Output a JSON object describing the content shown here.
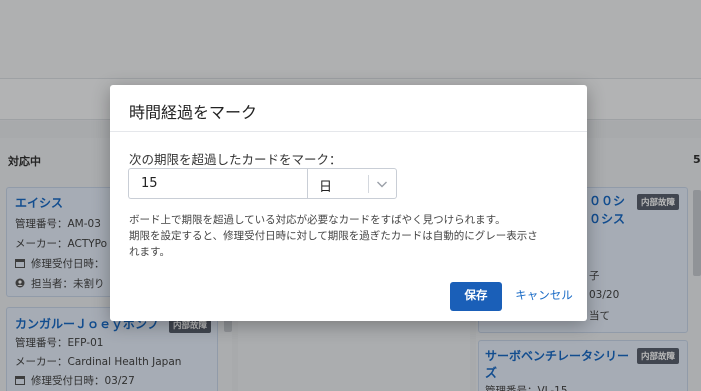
{
  "background": {
    "columns": [
      {
        "header": "対応中",
        "cards": [
          {
            "title": "エイシス",
            "mgmt": "管理番号：AM-03",
            "maker": "メーカー：ACTYPo",
            "received": "修理受付日時：",
            "assignee": "担当者：未割り"
          },
          {
            "title": "カンガルーＪｏｅｙポンプ",
            "tag": "内部故障",
            "mgmt": "管理番号：EFP-01",
            "maker": "メーカー：Cardinal Health Japan",
            "received": "修理受付日時：03/27"
          }
        ]
      },
      {
        "header": "5",
        "cards": [
          {
            "title_line1": "００シ",
            "title_line2": "０シス",
            "tag": "内部故障",
            "line1": "子",
            "line2": "03/20",
            "line3": "当て"
          },
          {
            "title_line1": "サーボベンチレータシリー",
            "title_line2": "ズ",
            "tag": "内部故障",
            "mgmt": "管理番号：VL-15"
          }
        ]
      }
    ]
  },
  "modal": {
    "title": "時間経過をマーク",
    "field_label": "次の期限を超過したカードをマーク：",
    "duration_value": "15",
    "unit_value": "日",
    "description_line1": "ボード上で期限を超過している対応が必要なカードをすばやく見つけられます。",
    "description_line2": "期限を設定すると、修理受付日時に対して期限を過ぎたカードは自動的にグレー表示さ",
    "description_line3": "れます。",
    "save_label": "保存",
    "cancel_label": "キャンセル"
  },
  "colors": {
    "primary": "#1a5fb8",
    "link": "#1a6bc6",
    "tag": "#5a6270"
  }
}
